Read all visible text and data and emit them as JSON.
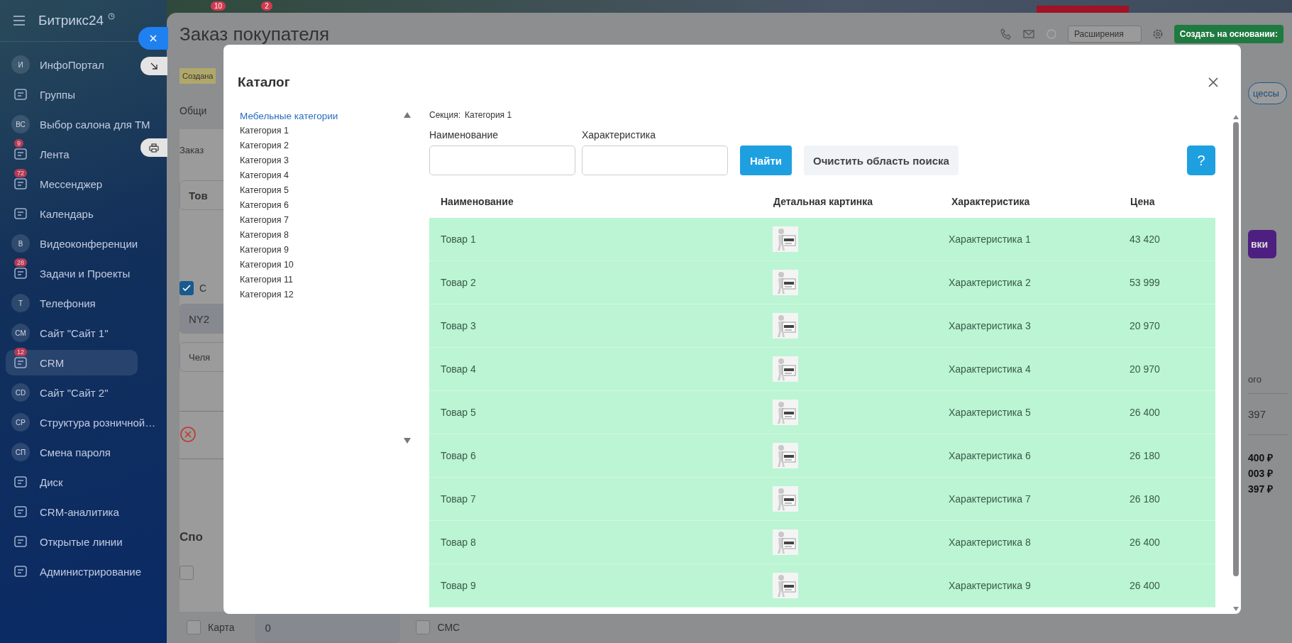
{
  "top_bar": {
    "badges": [
      "10",
      "2"
    ]
  },
  "sidebar": {
    "logo": "Битрикс24",
    "items": [
      {
        "label": "ИнфоПортал",
        "kind": "initials",
        "initials": "И",
        "selected": false
      },
      {
        "label": "Группы",
        "kind": "icon",
        "selected": false
      },
      {
        "label": "Выбор салона для ТМ",
        "kind": "initials",
        "initials": "ВС",
        "selected": false
      },
      {
        "label": "Лента",
        "kind": "icon",
        "badge": "9",
        "selected": false
      },
      {
        "label": "Мессенджер",
        "kind": "icon",
        "badge": "72",
        "selected": false
      },
      {
        "label": "Календарь",
        "kind": "icon",
        "selected": false
      },
      {
        "label": "Видеоконференции",
        "kind": "initials",
        "initials": "В",
        "selected": false
      },
      {
        "label": "Задачи и Проекты",
        "kind": "icon",
        "badge": "28",
        "selected": false
      },
      {
        "label": "Телефония",
        "kind": "initials",
        "initials": "Т",
        "selected": false
      },
      {
        "label": "Сайт \"Сайт 1\"",
        "kind": "initials",
        "initials": "СМ",
        "selected": false
      },
      {
        "label": "CRM",
        "kind": "icon",
        "badge": "12",
        "selected": true
      },
      {
        "label": "Сайт \"Сайт 2\"",
        "kind": "initials",
        "initials": "СD",
        "selected": false
      },
      {
        "label": "Структура розничной…",
        "kind": "initials",
        "initials": "СР",
        "selected": false
      },
      {
        "label": "Смена пароля",
        "kind": "initials",
        "initials": "СП",
        "selected": false
      },
      {
        "label": "Диск",
        "kind": "icon",
        "selected": false
      },
      {
        "label": "CRM-аналитика",
        "kind": "icon",
        "selected": false
      },
      {
        "label": "Открытые линии",
        "kind": "icon",
        "selected": false
      },
      {
        "label": "Администрирование",
        "kind": "icon",
        "selected": false
      }
    ]
  },
  "page": {
    "title": "Заказ покупателя",
    "extensions_dropdown": "Расширения",
    "create_button": "Создать на основании:",
    "stage_badge": "Создана",
    "tab": "Общи",
    "processes_button": "цессы",
    "card_title": "Заказ",
    "product_field": "Тов",
    "option": {
      "label": "С",
      "checked": true
    },
    "number_field": "NY2",
    "city_field": "Челя",
    "delivery_button": "вки",
    "total_heading": "ого",
    "total_value": "397",
    "sums": [
      "400 ₽",
      "003 ₽",
      "397 ₽"
    ],
    "payment_heading": "Спо",
    "payment_checkbox": {
      "checked": false
    },
    "payment_options": [
      {
        "label": "Карта",
        "checked": false
      },
      {
        "label": "СМС",
        "checked": false
      }
    ],
    "amount_field": "0"
  },
  "catalog": {
    "title": "Каталог",
    "tree": [
      {
        "label": "Мебельные категории",
        "selected": true
      },
      {
        "label": "Категория 1",
        "selected": false
      },
      {
        "label": "Категория 2",
        "selected": false
      },
      {
        "label": "Категория 3",
        "selected": false
      },
      {
        "label": "Категория 4",
        "selected": false
      },
      {
        "label": "Категория 5",
        "selected": false
      },
      {
        "label": "Категория 6",
        "selected": false
      },
      {
        "label": "Категория 7",
        "selected": false
      },
      {
        "label": "Категория 8",
        "selected": false
      },
      {
        "label": "Категория 9",
        "selected": false
      },
      {
        "label": "Категория 10",
        "selected": false
      },
      {
        "label": "Категория 11",
        "selected": false
      },
      {
        "label": "Категория 12",
        "selected": false
      }
    ],
    "section_label": "Секция:",
    "section_value": "Категория 1",
    "filters": [
      {
        "label": "Наименование"
      },
      {
        "label": "Характеристика"
      }
    ],
    "find_button": "Найти",
    "clear_button": "Очистить область поиска",
    "help_button": "?",
    "table": {
      "columns": [
        "Наименование",
        "Детальная картинка",
        "Характеристика",
        "Цена"
      ],
      "rows": [
        {
          "name": "Товар 1",
          "characteristic": "Характеристика 1",
          "price": "43 420"
        },
        {
          "name": "Товар 2",
          "characteristic": "Характеристика 2",
          "price": "53 999"
        },
        {
          "name": "Товар 3",
          "characteristic": "Характеристика 3",
          "price": "20 970"
        },
        {
          "name": "Товар 4",
          "characteristic": "Характеристика 4",
          "price": "20 970"
        },
        {
          "name": "Товар 5",
          "characteristic": "Характеристика 5",
          "price": "26 400"
        },
        {
          "name": "Товар 6",
          "characteristic": "Характеристика 6",
          "price": "26 180"
        },
        {
          "name": "Товар 7",
          "characteristic": "Характеристика 7",
          "price": "26 180"
        },
        {
          "name": "Товар 8",
          "characteristic": "Характеристика 8",
          "price": "26 400"
        },
        {
          "name": "Товар 9",
          "characteristic": "Характеристика 9",
          "price": "26 400"
        }
      ]
    }
  }
}
